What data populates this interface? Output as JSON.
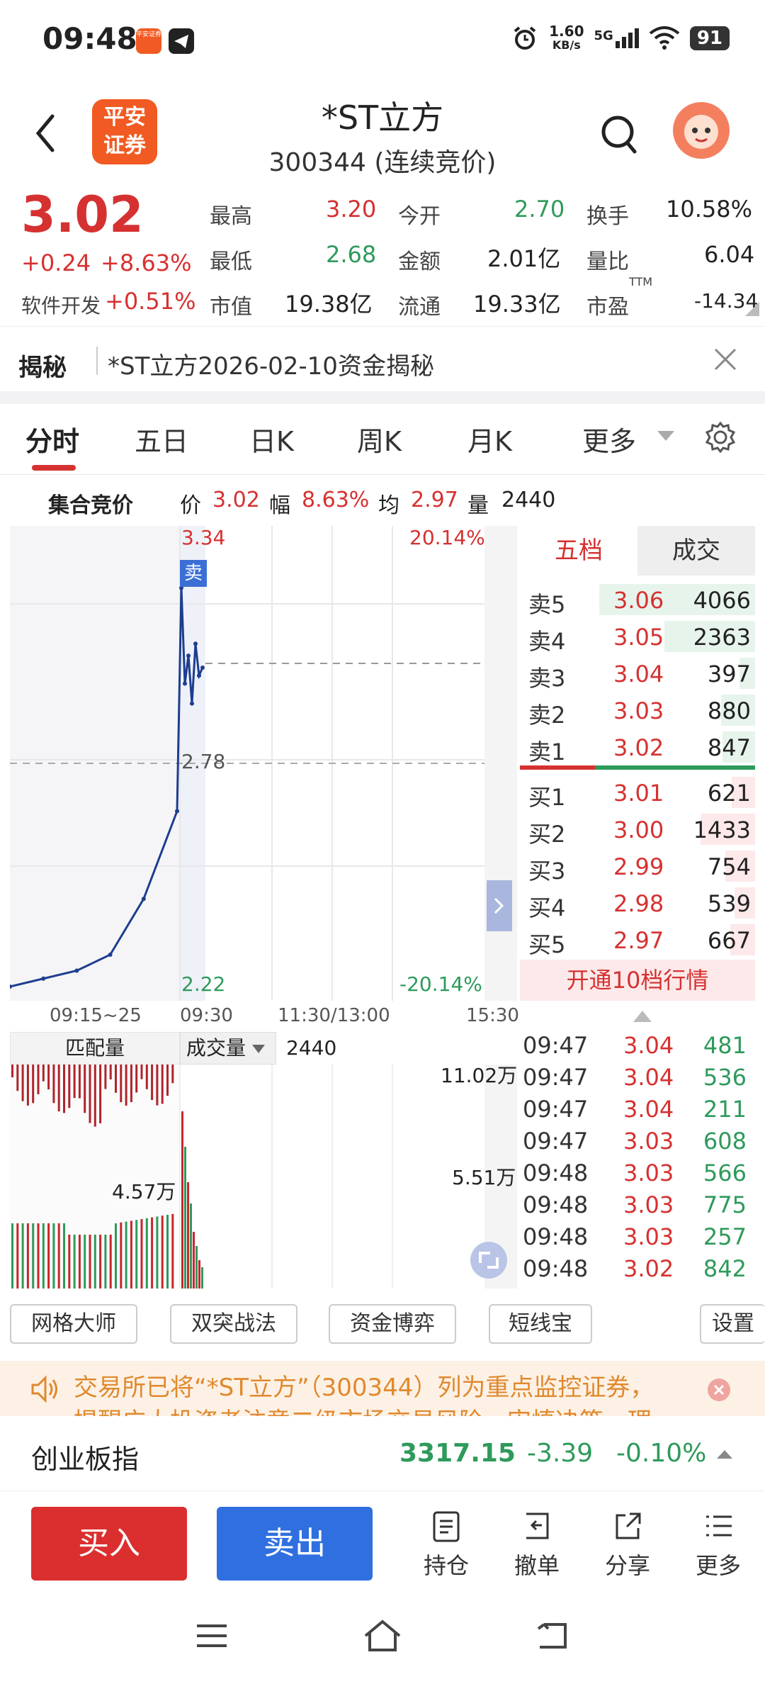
{
  "status_bar": {
    "time": "09:48",
    "app_icon_label": "平安证券",
    "net_speed_value": "1.60",
    "net_speed_unit": "KB/s",
    "network": "5G",
    "battery": "91"
  },
  "header": {
    "logo_text_1": "平安",
    "logo_text_2": "证券",
    "stock_name": "*ST立方",
    "stock_code_status": "300344 (连续竞价)"
  },
  "quote": {
    "price": "3.02",
    "change": "+0.24",
    "change_pct": "+8.63%",
    "sector_name": "软件开发",
    "sector_pct": "+0.51%",
    "high_label": "最高",
    "high": "3.20",
    "low_label": "最低",
    "low": "2.68",
    "mktcap_label": "市值",
    "mktcap": "19.38亿",
    "open_label": "今开",
    "open": "2.70",
    "amount_label": "金额",
    "amount": "2.01亿",
    "float_label": "流通",
    "float": "19.33亿",
    "turnover_label": "换手",
    "turnover": "10.58%",
    "volratio_label": "量比",
    "volratio": "6.04",
    "pe_label": "市盈",
    "pe_sup": "TTM",
    "pe": "-14.34"
  },
  "reveal": {
    "label": "揭秘",
    "text": "*ST立方2026-02-10资金揭秘"
  },
  "tabs": {
    "t1": "分时",
    "t2": "五日",
    "t3": "日K",
    "t4": "周K",
    "t5": "月K",
    "t6": "更多"
  },
  "auction": {
    "title": "集合竞价",
    "price_label": "价",
    "price": "3.02",
    "range_label": "幅",
    "range": "8.63%",
    "avg_label": "均",
    "avg": "2.97",
    "vol_label": "量",
    "vol": "2440"
  },
  "chart": {
    "top_price": "3.34",
    "top_pct": "20.14%",
    "mid_price": "2.78",
    "bottom_price": "2.22",
    "bottom_pct": "-20.14%",
    "sell_marker": "卖",
    "time_labels": {
      "t1": "09:15~25",
      "t2": "09:30",
      "t3": "11:30/13:00",
      "t4": "15:30"
    }
  },
  "chart_data": {
    "type": "line",
    "x": [
      "09:15",
      "09:18",
      "09:21",
      "09:23",
      "09:24",
      "09:25",
      "09:30",
      "09:33",
      "09:36",
      "09:39",
      "09:42",
      "09:45",
      "09:48"
    ],
    "series": [
      {
        "values": [
          2.22,
          2.24,
          2.26,
          2.3,
          2.44,
          2.66,
          3.22,
          2.98,
          3.05,
          2.93,
          3.08,
          3.0,
          3.02
        ]
      }
    ],
    "ylim": [
      2.22,
      3.34
    ]
  },
  "orderbook": {
    "tab_five": "五档",
    "tab_deals": "成交",
    "asks": [
      {
        "label": "卖5",
        "price": "3.06",
        "vol": "4066",
        "fill": 1.0
      },
      {
        "label": "卖4",
        "price": "3.05",
        "vol": "2363",
        "fill": 0.58
      },
      {
        "label": "卖3",
        "price": "3.04",
        "vol": "397",
        "fill": 0.1
      },
      {
        "label": "卖2",
        "price": "3.03",
        "vol": "880",
        "fill": 0.22
      },
      {
        "label": "卖1",
        "price": "3.02",
        "vol": "847",
        "fill": 0.21
      }
    ],
    "bids": [
      {
        "label": "买1",
        "price": "3.01",
        "vol": "621",
        "fill": 0.15
      },
      {
        "label": "买2",
        "price": "3.00",
        "vol": "1433",
        "fill": 0.35
      },
      {
        "label": "买3",
        "price": "2.99",
        "vol": "754",
        "fill": 0.19
      },
      {
        "label": "买4",
        "price": "2.98",
        "vol": "539",
        "fill": 0.13
      },
      {
        "label": "买5",
        "price": "2.97",
        "vol": "667",
        "fill": 0.16
      }
    ],
    "open10": "开通10档行情"
  },
  "volume": {
    "match_label": "匹配量",
    "vol_label": "成交量",
    "vol_value": "2440",
    "max_label": "11.02万",
    "mid_label": "5.51万",
    "auction_label": "4.57万"
  },
  "ticks": [
    {
      "time": "09:47",
      "price": "3.04",
      "vol": "481"
    },
    {
      "time": "09:47",
      "price": "3.04",
      "vol": "536"
    },
    {
      "time": "09:47",
      "price": "3.04",
      "vol": "211"
    },
    {
      "time": "09:47",
      "price": "3.03",
      "vol": "608"
    },
    {
      "time": "09:48",
      "price": "3.03",
      "vol": "566"
    },
    {
      "time": "09:48",
      "price": "3.03",
      "vol": "775"
    },
    {
      "time": "09:48",
      "price": "3.03",
      "vol": "257"
    },
    {
      "time": "09:48",
      "price": "3.02",
      "vol": "842"
    }
  ],
  "tools": {
    "b1": "网格大师",
    "b2": "双突战法",
    "b3": "资金博弈",
    "b4": "短线宝",
    "b5": "设置"
  },
  "notice": {
    "text": "交易所已将“*ST立方”（300344）列为重点监控证券，",
    "text2": "提醒广大投资者注意二级市场交易风险，审慎决策，理"
  },
  "index": {
    "name": "创业板指",
    "value": "3317.15",
    "change": "-3.39",
    "pct": "-0.10%"
  },
  "actions": {
    "buy": "买入",
    "sell": "卖出",
    "position": "持仓",
    "cancel": "撤单",
    "share": "分享",
    "more": "更多"
  },
  "colors": {
    "up": "#d63131",
    "down": "#2e9a5b",
    "buy_btn": "#db2f2f",
    "sell_btn": "#2f6fe0",
    "brand": "#f15a22"
  }
}
